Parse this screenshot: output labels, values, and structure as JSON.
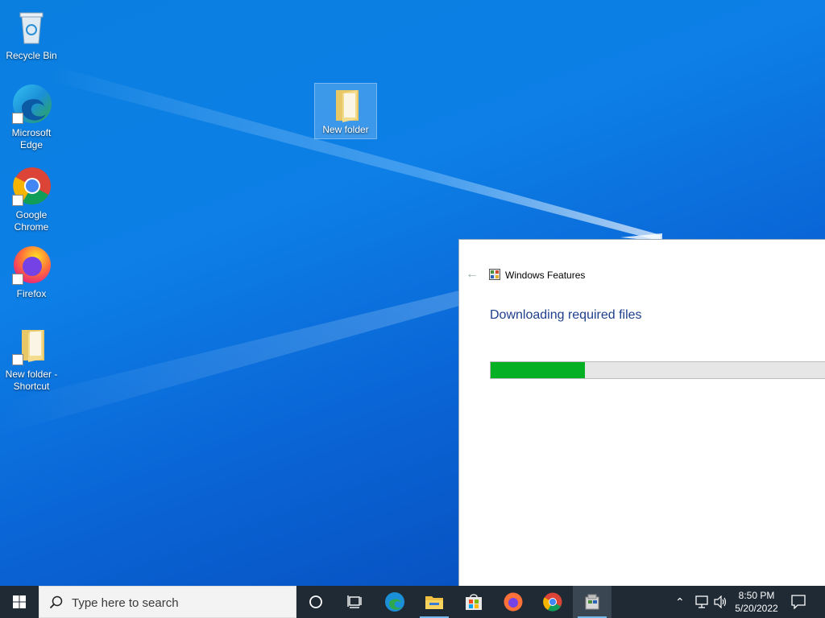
{
  "desktop": {
    "icons": [
      {
        "label": "Recycle Bin",
        "icon": "recycle-bin-icon"
      },
      {
        "label": "Microsoft Edge",
        "icon": "edge-icon"
      },
      {
        "label": "Google Chrome",
        "icon": "chrome-icon"
      },
      {
        "label": "Firefox",
        "icon": "firefox-icon"
      },
      {
        "label": "New folder - Shortcut",
        "icon": "folder-shortcut-icon"
      },
      {
        "label": "New folder",
        "icon": "folder-icon",
        "selected": true
      }
    ]
  },
  "window": {
    "title": "Windows Features",
    "heading": "Downloading required files",
    "progress": 0.28,
    "progress_color": "#06b025"
  },
  "taskbar": {
    "search_placeholder": "Type here to search",
    "apps": [
      "start-icon",
      "cortana-icon",
      "task-view-icon",
      "edge-icon",
      "file-explorer-icon",
      "store-icon",
      "firefox-icon",
      "chrome-icon",
      "windows-features-icon"
    ],
    "time": "8:50 PM",
    "date": "5/20/2022"
  }
}
